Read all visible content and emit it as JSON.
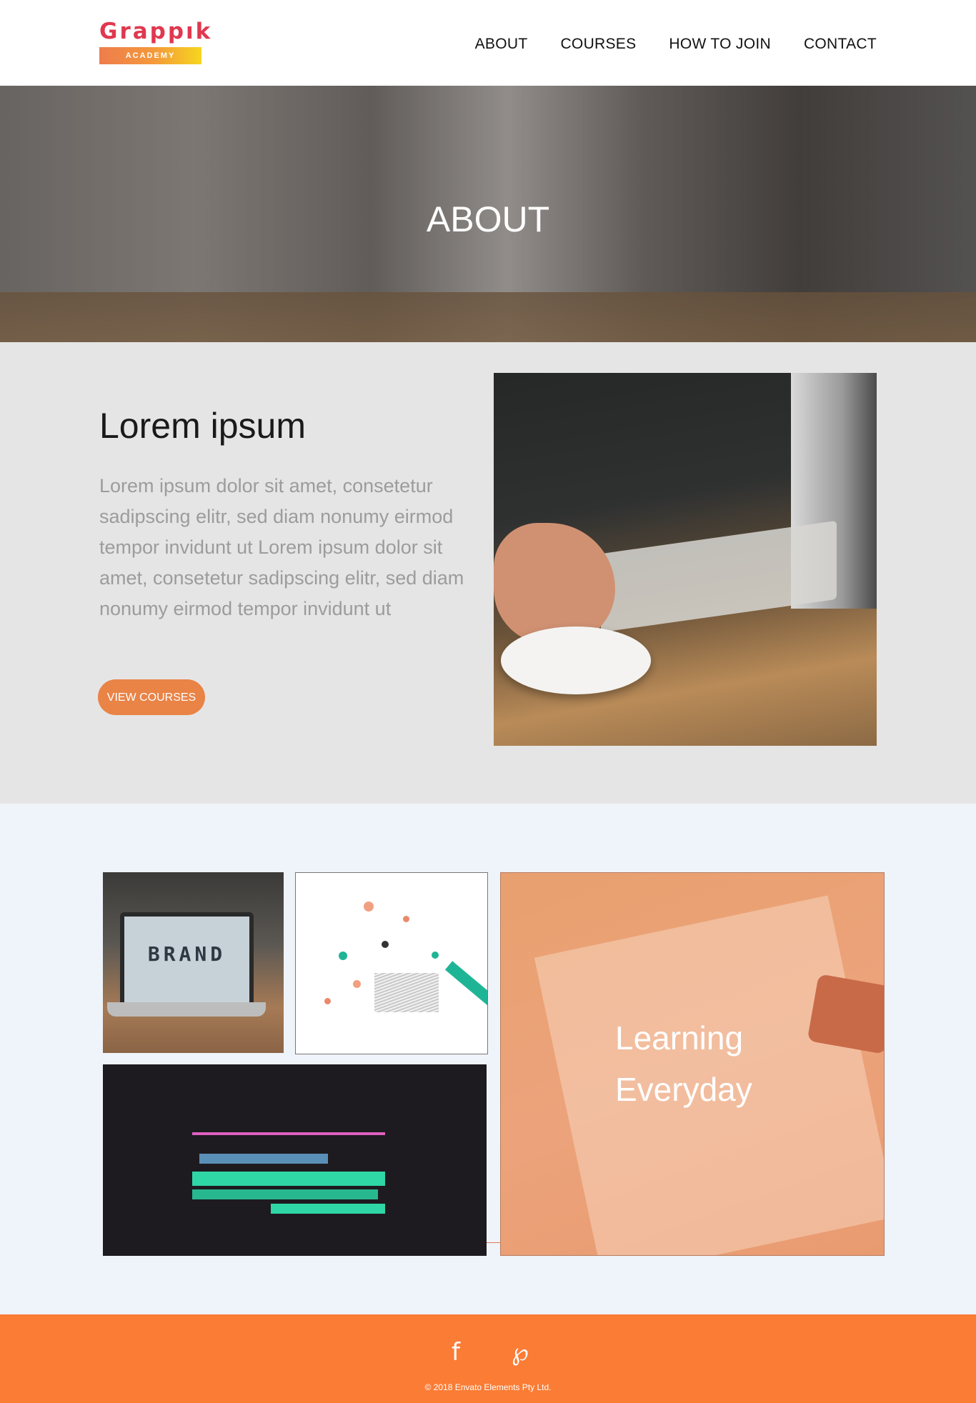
{
  "header": {
    "logo_word": "Grappık",
    "logo_tag": "ACADEMY",
    "nav": [
      "ABOUT",
      "COURSES",
      "HOW TO JOIN",
      "CONTACT"
    ]
  },
  "hero": {
    "title": "ABOUT"
  },
  "about": {
    "title": "Lorem ipsum",
    "text": "Lorem ipsum dolor sit amet, consetetur sadipscing elitr, sed diam nonumy eirmod tempor invidunt ut Lorem ipsum dolor sit amet, consetetur sadipscing elitr, sed diam nonumy eirmod tempor invidunt ut",
    "button_label": "VIEW COURSES"
  },
  "gallery": {
    "brand_text": "BRAND",
    "learning_line1": "Learning",
    "learning_line2": "Everyday"
  },
  "footer": {
    "icons": [
      "facebook-icon",
      "pinterest-icon"
    ],
    "facebook_glyph": "f",
    "pinterest_glyph": "℘",
    "copyright": "© 2018 Envato Elements Pty Ltd."
  },
  "colors": {
    "accent": "#e98346",
    "footer": "#fa7c35",
    "logo": "#e0384f"
  }
}
